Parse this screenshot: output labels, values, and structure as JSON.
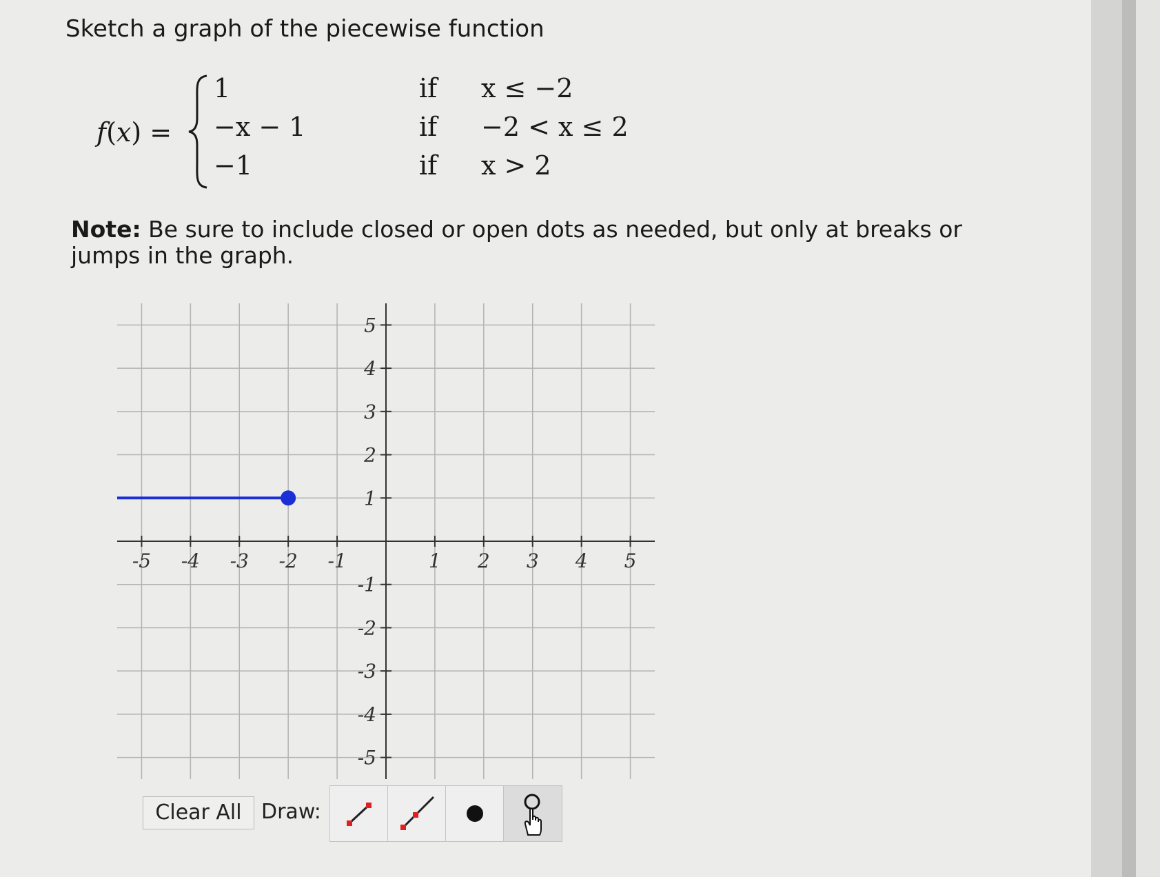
{
  "instruction": "Sketch a graph of the piecewise function",
  "formula": {
    "lhs_name": "f",
    "lhs_var": "x",
    "cases": [
      {
        "value": "1",
        "if": "if",
        "condition": "x ≤ −2"
      },
      {
        "value": "−x − 1",
        "if": "if",
        "condition": "−2 < x ≤ 2"
      },
      {
        "value": "−1",
        "if": "if",
        "condition": "x > 2"
      }
    ]
  },
  "note": {
    "label": "Note:",
    "text": "Be sure to include closed or open dots as needed, but only at breaks or jumps in the graph."
  },
  "graph": {
    "x_range": [
      -5.5,
      5.5
    ],
    "y_range": [
      -5.5,
      5.5
    ],
    "x_tick_labels": [
      "-5",
      "-4",
      "-3",
      "-2",
      "-1",
      "1",
      "2",
      "3",
      "4",
      "5"
    ],
    "y_tick_labels": [
      "5",
      "4",
      "3",
      "2",
      "1",
      "-1",
      "-2",
      "-3",
      "-4",
      "-5"
    ],
    "drawn_segment": {
      "x_from": -5.5,
      "x_to": -2,
      "y": 1,
      "color": "#1a2fd6"
    },
    "closed_dot": {
      "x": -2,
      "y": 1,
      "color": "#1a2fd6"
    }
  },
  "toolbar": {
    "clear_all": "Clear All",
    "draw_label": "Draw:",
    "tools": [
      "segment-tool",
      "ray-tool",
      "closed-dot-tool",
      "open-dot-tool"
    ]
  }
}
